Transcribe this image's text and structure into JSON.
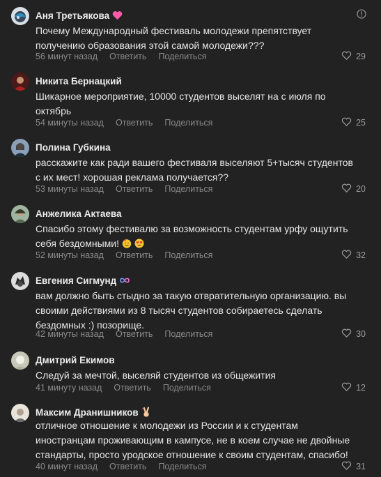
{
  "comments": [
    {
      "author": "Аня Третьякова",
      "text_lines": [
        "Почему Международный фестиваль молодежи препятствует",
        "получению образования этой самой молодежи???"
      ],
      "time": "56 минут назад",
      "reply_label": "Ответить",
      "share_label": "Поделиться",
      "likes": "29"
    },
    {
      "author": "Никита Бернацкий",
      "text_lines": [
        "Шикарное мероприятие, 10000 студентов выселят на с июля по",
        "октябрь"
      ],
      "time": "54 минуты назад",
      "reply_label": "Ответить",
      "share_label": "Поделиться",
      "likes": "25"
    },
    {
      "author": "Полина Губкина",
      "text_lines": [
        "расскажите как ради вашего фестиваля выселяют 5+тысяч студентов",
        "с их мест! хорошая реклама получается??"
      ],
      "time": "53 минуты назад",
      "reply_label": "Ответить",
      "share_label": "Поделиться",
      "likes": "20"
    },
    {
      "author": "Анжелика Актаева",
      "text_lines": [
        "Спасибо этому фестивалю за возможность студентам урфу ощутить",
        "себя бездомными!"
      ],
      "time": "52 минуты назад",
      "reply_label": "Ответить",
      "share_label": "Поделиться",
      "likes": "32"
    },
    {
      "author": "Евгения Сигмунд",
      "text_lines": [
        "вам должно быть стыдно за такую отвратительную организацию. вы",
        "своими действиями из 8 тысяч студентов собираетесь сделать",
        "бездомных :) позорище."
      ],
      "time": "42 минуты назад",
      "reply_label": "Ответить",
      "share_label": "Поделиться",
      "likes": "30"
    },
    {
      "author": "Дмитрий Екимов",
      "text_lines": [
        "Следуй за мечтой, выселяй студентов из общежития"
      ],
      "time": "41 минуту назад",
      "reply_label": "Ответить",
      "share_label": "Поделиться",
      "likes": "12"
    },
    {
      "author": "Максим Дранишников",
      "text_lines": [
        "отличное отношение к молодежи из России и к студентам",
        "иностранцам проживающим в кампусе, не в коем случае не двойные",
        "стандарты, просто уродское отношение к своим студентам, спасибо!"
      ],
      "time": "40 минут назад",
      "reply_label": "Ответить",
      "share_label": "Поделиться",
      "likes": "31"
    }
  ],
  "icons": {
    "heart": "heart-outline-icon",
    "more": "info-circle-icon",
    "badge_heart": "pink-heart-icon",
    "badge_infinity": "infinity-icon",
    "badge_victory": "victory-hand-icon",
    "emoji_party": "partying-face-emoji",
    "emoji_love": "heart-eyes-emoji"
  },
  "colors": {
    "background": "#222222",
    "text": "#e6e6e6",
    "meta": "#8a8a8a",
    "badge_heart": "#ff5aa8"
  }
}
